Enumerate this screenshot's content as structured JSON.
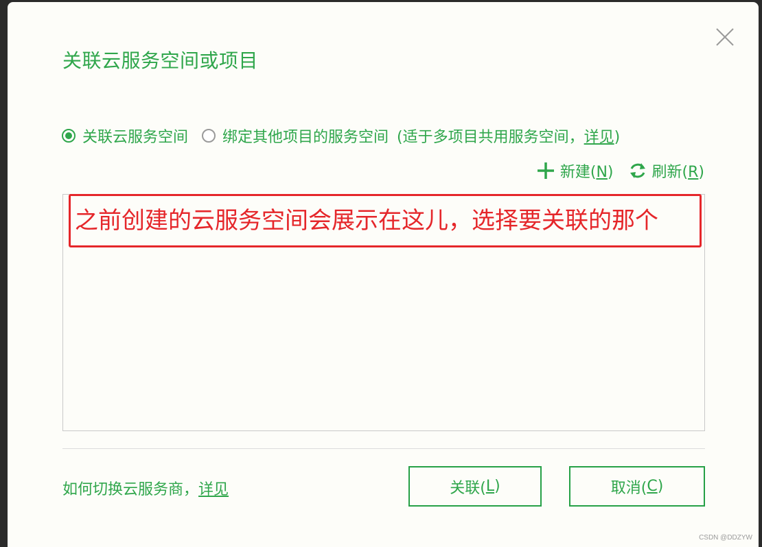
{
  "dialog": {
    "title": "关联云服务空间或项目",
    "close_icon": "close-icon"
  },
  "options": {
    "link_space": {
      "label": "关联云服务空间",
      "checked": true
    },
    "bind_other": {
      "label": "绑定其他项目的服务空间",
      "note_prefix": "(适于多项目共用服务空间，",
      "note_link": "详见",
      "note_suffix": ")",
      "checked": false
    }
  },
  "toolbar": {
    "new_label": "新建(",
    "new_key": "N",
    "new_suffix": ")",
    "new_icon": "plus-icon",
    "refresh_label": "刷新(",
    "refresh_key": "R",
    "refresh_suffix": ")",
    "refresh_icon": "refresh-icon"
  },
  "annotation": {
    "text": "之前创建的云服务空间会展示在这儿，选择要关联的那个"
  },
  "footer": {
    "help_text": "如何切换云服务商，",
    "help_link": "详见",
    "link_button_prefix": "关联(",
    "link_button_key": "L",
    "link_button_suffix": ")",
    "cancel_button_prefix": "取消(",
    "cancel_button_key": "C",
    "cancel_button_suffix": ")"
  },
  "watermark": "CSDN @DDZYW",
  "colors": {
    "accent": "#2fa64b",
    "annotation": "#e5262a",
    "background": "#fdfdf9"
  }
}
